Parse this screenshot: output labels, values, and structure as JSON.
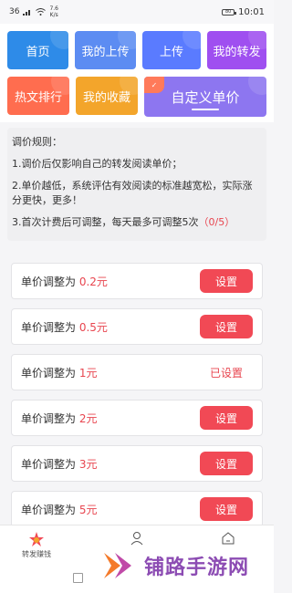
{
  "status_bar": {
    "signal": "36",
    "net_speed_value": "7.6",
    "net_speed_unit": "K/s",
    "battery": "80",
    "time": "10:01"
  },
  "tiles": [
    {
      "label": "首页"
    },
    {
      "label": "我的上传"
    },
    {
      "label": "上传"
    },
    {
      "label": "我的转发"
    },
    {
      "label": "热文排行"
    },
    {
      "label": "我的收藏"
    },
    {
      "label": "自定义单价"
    }
  ],
  "rules": {
    "title": "调价规则：",
    "rule1": "1.调价后仅影响自己的转发阅读单价；",
    "rule2": "2.单价越低，系统评估有效阅读的标准越宽松，实际涨分更快，更多！",
    "rule3": "3.首次计费后可调整，每天最多可调整5次",
    "count": "（0/5）"
  },
  "price_rows": [
    {
      "label": "单价调整为",
      "value": "0.2元",
      "action": "设置",
      "done": false
    },
    {
      "label": "单价调整为",
      "value": "0.5元",
      "action": "设置",
      "done": false
    },
    {
      "label": "单价调整为",
      "value": "1元",
      "action": "已设置",
      "done": true
    },
    {
      "label": "单价调整为",
      "value": "2元",
      "action": "设置",
      "done": false
    },
    {
      "label": "单价调整为",
      "value": "3元",
      "action": "设置",
      "done": false
    },
    {
      "label": "单价调整为",
      "value": "5元",
      "action": "设置",
      "done": false
    }
  ],
  "bottom_nav": {
    "item1": "转发赚钱",
    "item2_icon": "person-icon",
    "item3_icon": "home-icon"
  },
  "watermark": {
    "text": "铺路手游网"
  },
  "colors": {
    "accent_red": "#f14955",
    "tile_blue": "#2e8be8",
    "tile_purple": "#9f4ff0",
    "tile_orange": "#ff6d4f",
    "tile_yellow": "#f3a52b",
    "tile_violet": "#8d76f0"
  }
}
